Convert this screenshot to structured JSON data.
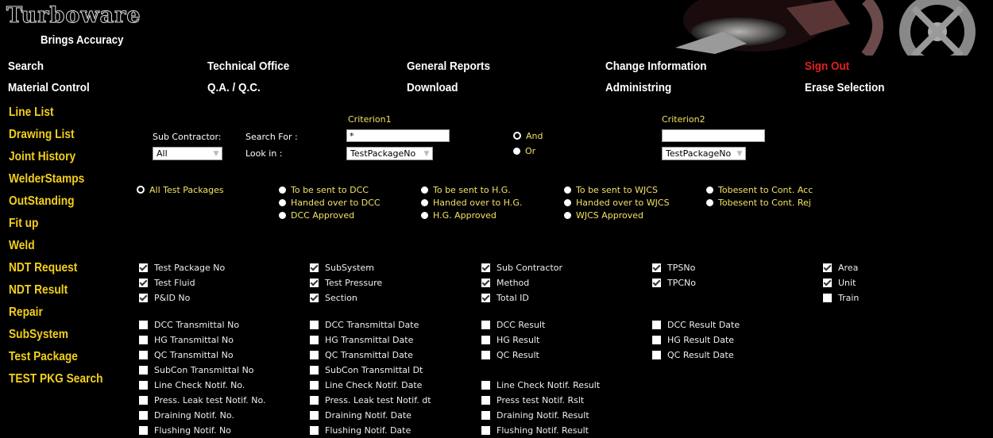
{
  "header": {
    "logo": "Turboware",
    "tagline": "Brings Accuracy"
  },
  "topnav": {
    "row1": [
      "Search",
      "Technical Office",
      "General Reports",
      "Change Information",
      "Sign Out"
    ],
    "row2": [
      "Material Control",
      "Q.A. / Q.C.",
      "Download",
      "Administring",
      "Erase Selection"
    ]
  },
  "sidenav": [
    "Line List",
    "Drawing List",
    "Joint History",
    "WelderStamps",
    "OutStanding",
    "Fit up",
    "Weld",
    "NDT Request",
    "NDT Result",
    "Repair",
    "SubSystem",
    "Test Package",
    "TEST PKG Search"
  ],
  "search": {
    "criterion1": "Criterion1",
    "criterion2": "Criterion2",
    "sub_contractor_label": "Sub Contractor:",
    "sub_contractor_value": "All",
    "search_for_label": "Search For :",
    "look_in_label": "Look in :",
    "search1_value": "*",
    "search2_value": "",
    "lookin1_value": "TestPackageNo",
    "lookin2_value": "TestPackageNo",
    "and_label": "And",
    "or_label": "Or"
  },
  "filters": {
    "all": "All Test Packages",
    "col1": [
      "To be sent to DCC",
      "Handed over to DCC",
      "DCC Approved"
    ],
    "col2": [
      "To be sent to H.G.",
      "Handed over to H.G.",
      "H.G. Approved"
    ],
    "col3": [
      "To be sent to WJCS",
      "Handed over to WJCS",
      "WJCS Approved"
    ],
    "col4": [
      "Tobesent to Cont. Acc",
      "Tobesent to Cont. Rej"
    ]
  },
  "columns": {
    "c1": [
      "Test Package No",
      "Test Fluid",
      "P&ID No"
    ],
    "c2": [
      "SubSystem",
      "Test Pressure",
      "Section"
    ],
    "c3": [
      "Sub Contractor",
      "Method",
      "Total ID"
    ],
    "c4": [
      "TPSNo",
      "TPCNo"
    ],
    "c5": [
      "Area",
      "Unit",
      "Train"
    ]
  },
  "columns2": {
    "c1": [
      "DCC Transmittal No",
      "HG Transmittal No",
      "QC Transmittal No",
      "SubCon Transmittal No",
      "Line Check Notif. No.",
      "Press. Leak test Notif. No.",
      "Draining Notif. No.",
      "Flushing Notif. No"
    ],
    "c2": [
      "DCC Transmittal Date",
      "HG Transmittal Date",
      "QC Transmittal Date",
      "SubCon Transmittal Dt",
      "Line Check Notif. Date",
      "Press. Leak test Notif. dt",
      "Draining Notif. Date",
      "Flushing Notif. Date"
    ],
    "c3": [
      "DCC Result",
      "HG Result",
      "QC Result",
      "",
      "Line Check Notif. Result",
      "Press test Notif. Rslt",
      "Draining Notif. Result",
      "Flushing Notif. Result"
    ],
    "c4": [
      "DCC Result Date",
      "HG Result Date",
      "QC Result Date"
    ]
  },
  "colors": {
    "accent": "#f2cf1a",
    "signout": "#e02020",
    "background": "#000000"
  }
}
